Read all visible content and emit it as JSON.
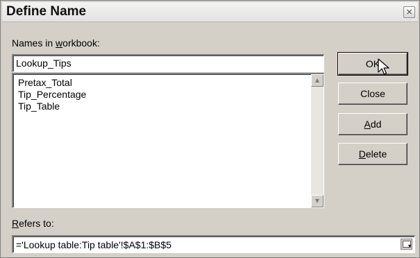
{
  "window": {
    "title": "Define Name",
    "close_glyph": "×"
  },
  "names_label": {
    "pre": "Names in ",
    "accel": "w",
    "post": "orkbook:"
  },
  "name_input": {
    "value": "Lookup_Tips"
  },
  "names_list": [
    "Pretax_Total",
    "Tip_Percentage",
    "Tip_Table"
  ],
  "refers_label": {
    "accel": "R",
    "post": "efers to:"
  },
  "refers_input": {
    "value": "='Lookup table:Tip table'!$A$1:$B$5"
  },
  "buttons": {
    "ok": "OK",
    "close": "Close",
    "add": {
      "accel": "A",
      "post": "dd"
    },
    "delete": {
      "accel": "D",
      "post": "elete"
    }
  },
  "icons": {
    "scroll_up": "scroll-up-arrow-icon",
    "scroll_down": "scroll-down-arrow-icon",
    "collapse": "collapse-dialog-icon",
    "cursor": "mouse-pointer-icon"
  }
}
